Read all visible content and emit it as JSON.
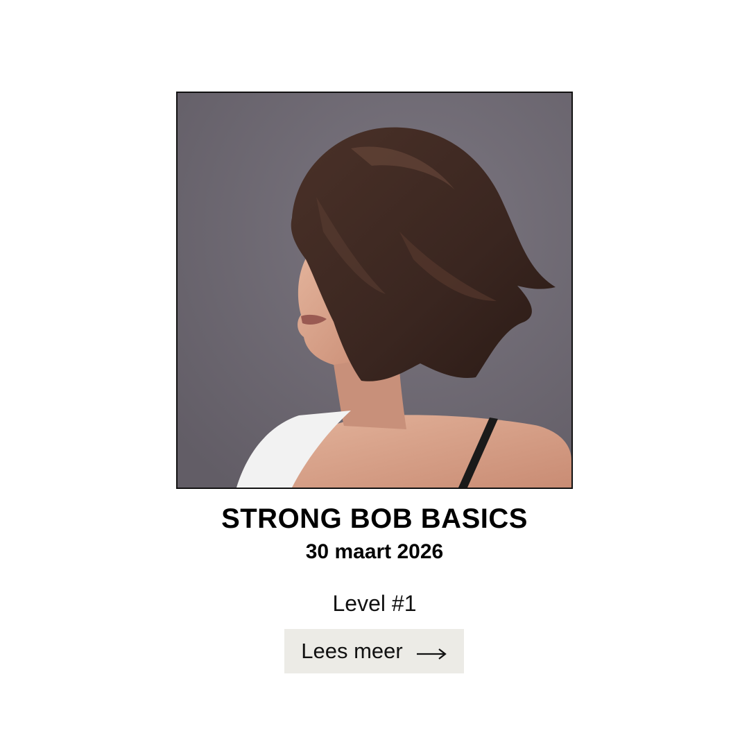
{
  "course": {
    "title": "STRONG BOB BASICS",
    "date": "30 maart 2026",
    "level": "Level #1"
  },
  "cta": {
    "label": "Lees meer",
    "icon": "arrow-right-icon"
  },
  "photo": {
    "subject": "model-with-bob-haircut",
    "background_color": "#6f6a72",
    "hair_color": "#3a2620",
    "skin_color": "#d9a88f"
  },
  "colors": {
    "page_background": "#ffffff",
    "button_background": "#ecebe6",
    "text": "#000000"
  }
}
